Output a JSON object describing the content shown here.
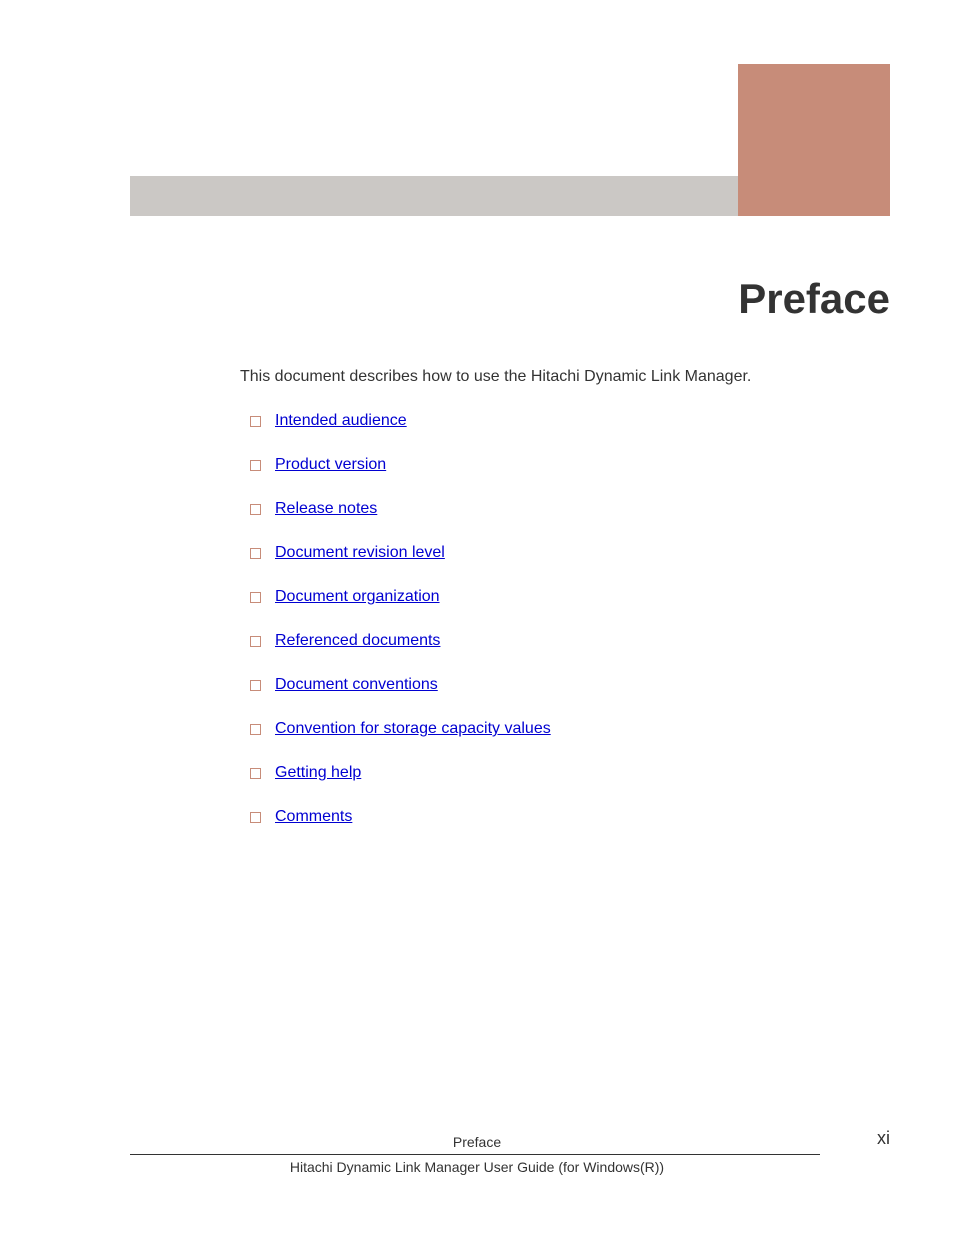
{
  "title": "Preface",
  "intro": "This document describes how to use the Hitachi Dynamic Link Manager.",
  "toc_items": [
    "Intended audience",
    "Product version",
    "Release notes",
    "Document revision level",
    "Document organization",
    "Referenced documents",
    "Document conventions",
    "Convention for storage capacity values",
    "Getting help",
    "Comments"
  ],
  "footer": {
    "section": "Preface",
    "doc_title": "Hitachi Dynamic Link Manager User Guide (for Windows(R))",
    "page_number": "xi"
  }
}
